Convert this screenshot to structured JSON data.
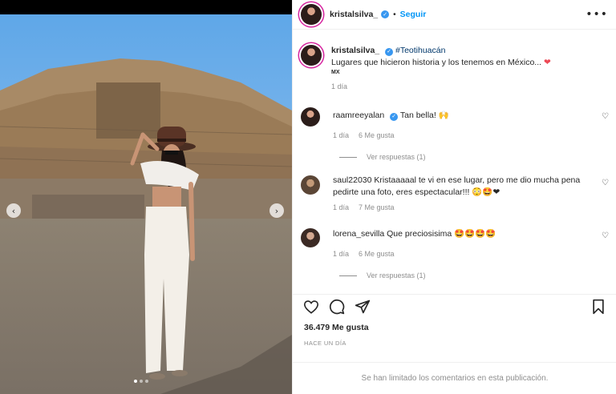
{
  "post": {
    "author": "kristalsilva_",
    "follow_label": "Seguir",
    "more_label": "•••",
    "image_dots": 3,
    "active_dot": 0
  },
  "caption": {
    "user": "kristalsilva_",
    "hashtag": "#Teotihuacán",
    "text": "Lugares que hicieron historia y los tenemos en México...",
    "country_tag": "MX",
    "time": "1 día"
  },
  "comments": [
    {
      "user": "raamreeyalan",
      "verified": true,
      "text": "Tan bella! 🙌",
      "time": "1 día",
      "likes": "6 Me gusta",
      "replies": "Ver respuestas (1)"
    },
    {
      "user": "saul22030",
      "verified": false,
      "text": "Kristaaaaal te vi en ese lugar, pero me dio mucha pena pedirte una foto, eres espectacular!!! 😳🤩❤",
      "time": "1 día",
      "likes": "7 Me gusta",
      "replies": ""
    },
    {
      "user": "lorena_sevilla",
      "verified": false,
      "text": "Que preciosisima 🤩🤩🤩🤩",
      "time": "1 día",
      "likes": "6 Me gusta",
      "replies": "Ver respuestas (1)"
    }
  ],
  "stats": {
    "likes": "36.479 Me gusta",
    "time_ago": "HACE UN DÍA"
  },
  "footer": {
    "limited_notice": "Se han limitado los comentarios en esta publicación."
  },
  "icons": {
    "like": "heart-icon",
    "comment": "comment-icon",
    "share": "share-icon",
    "save": "bookmark-icon"
  },
  "colors": {
    "accent": "#0095f6",
    "verified": "#3897f0",
    "muted": "#8e8e8e",
    "heart": "#ed4956"
  }
}
